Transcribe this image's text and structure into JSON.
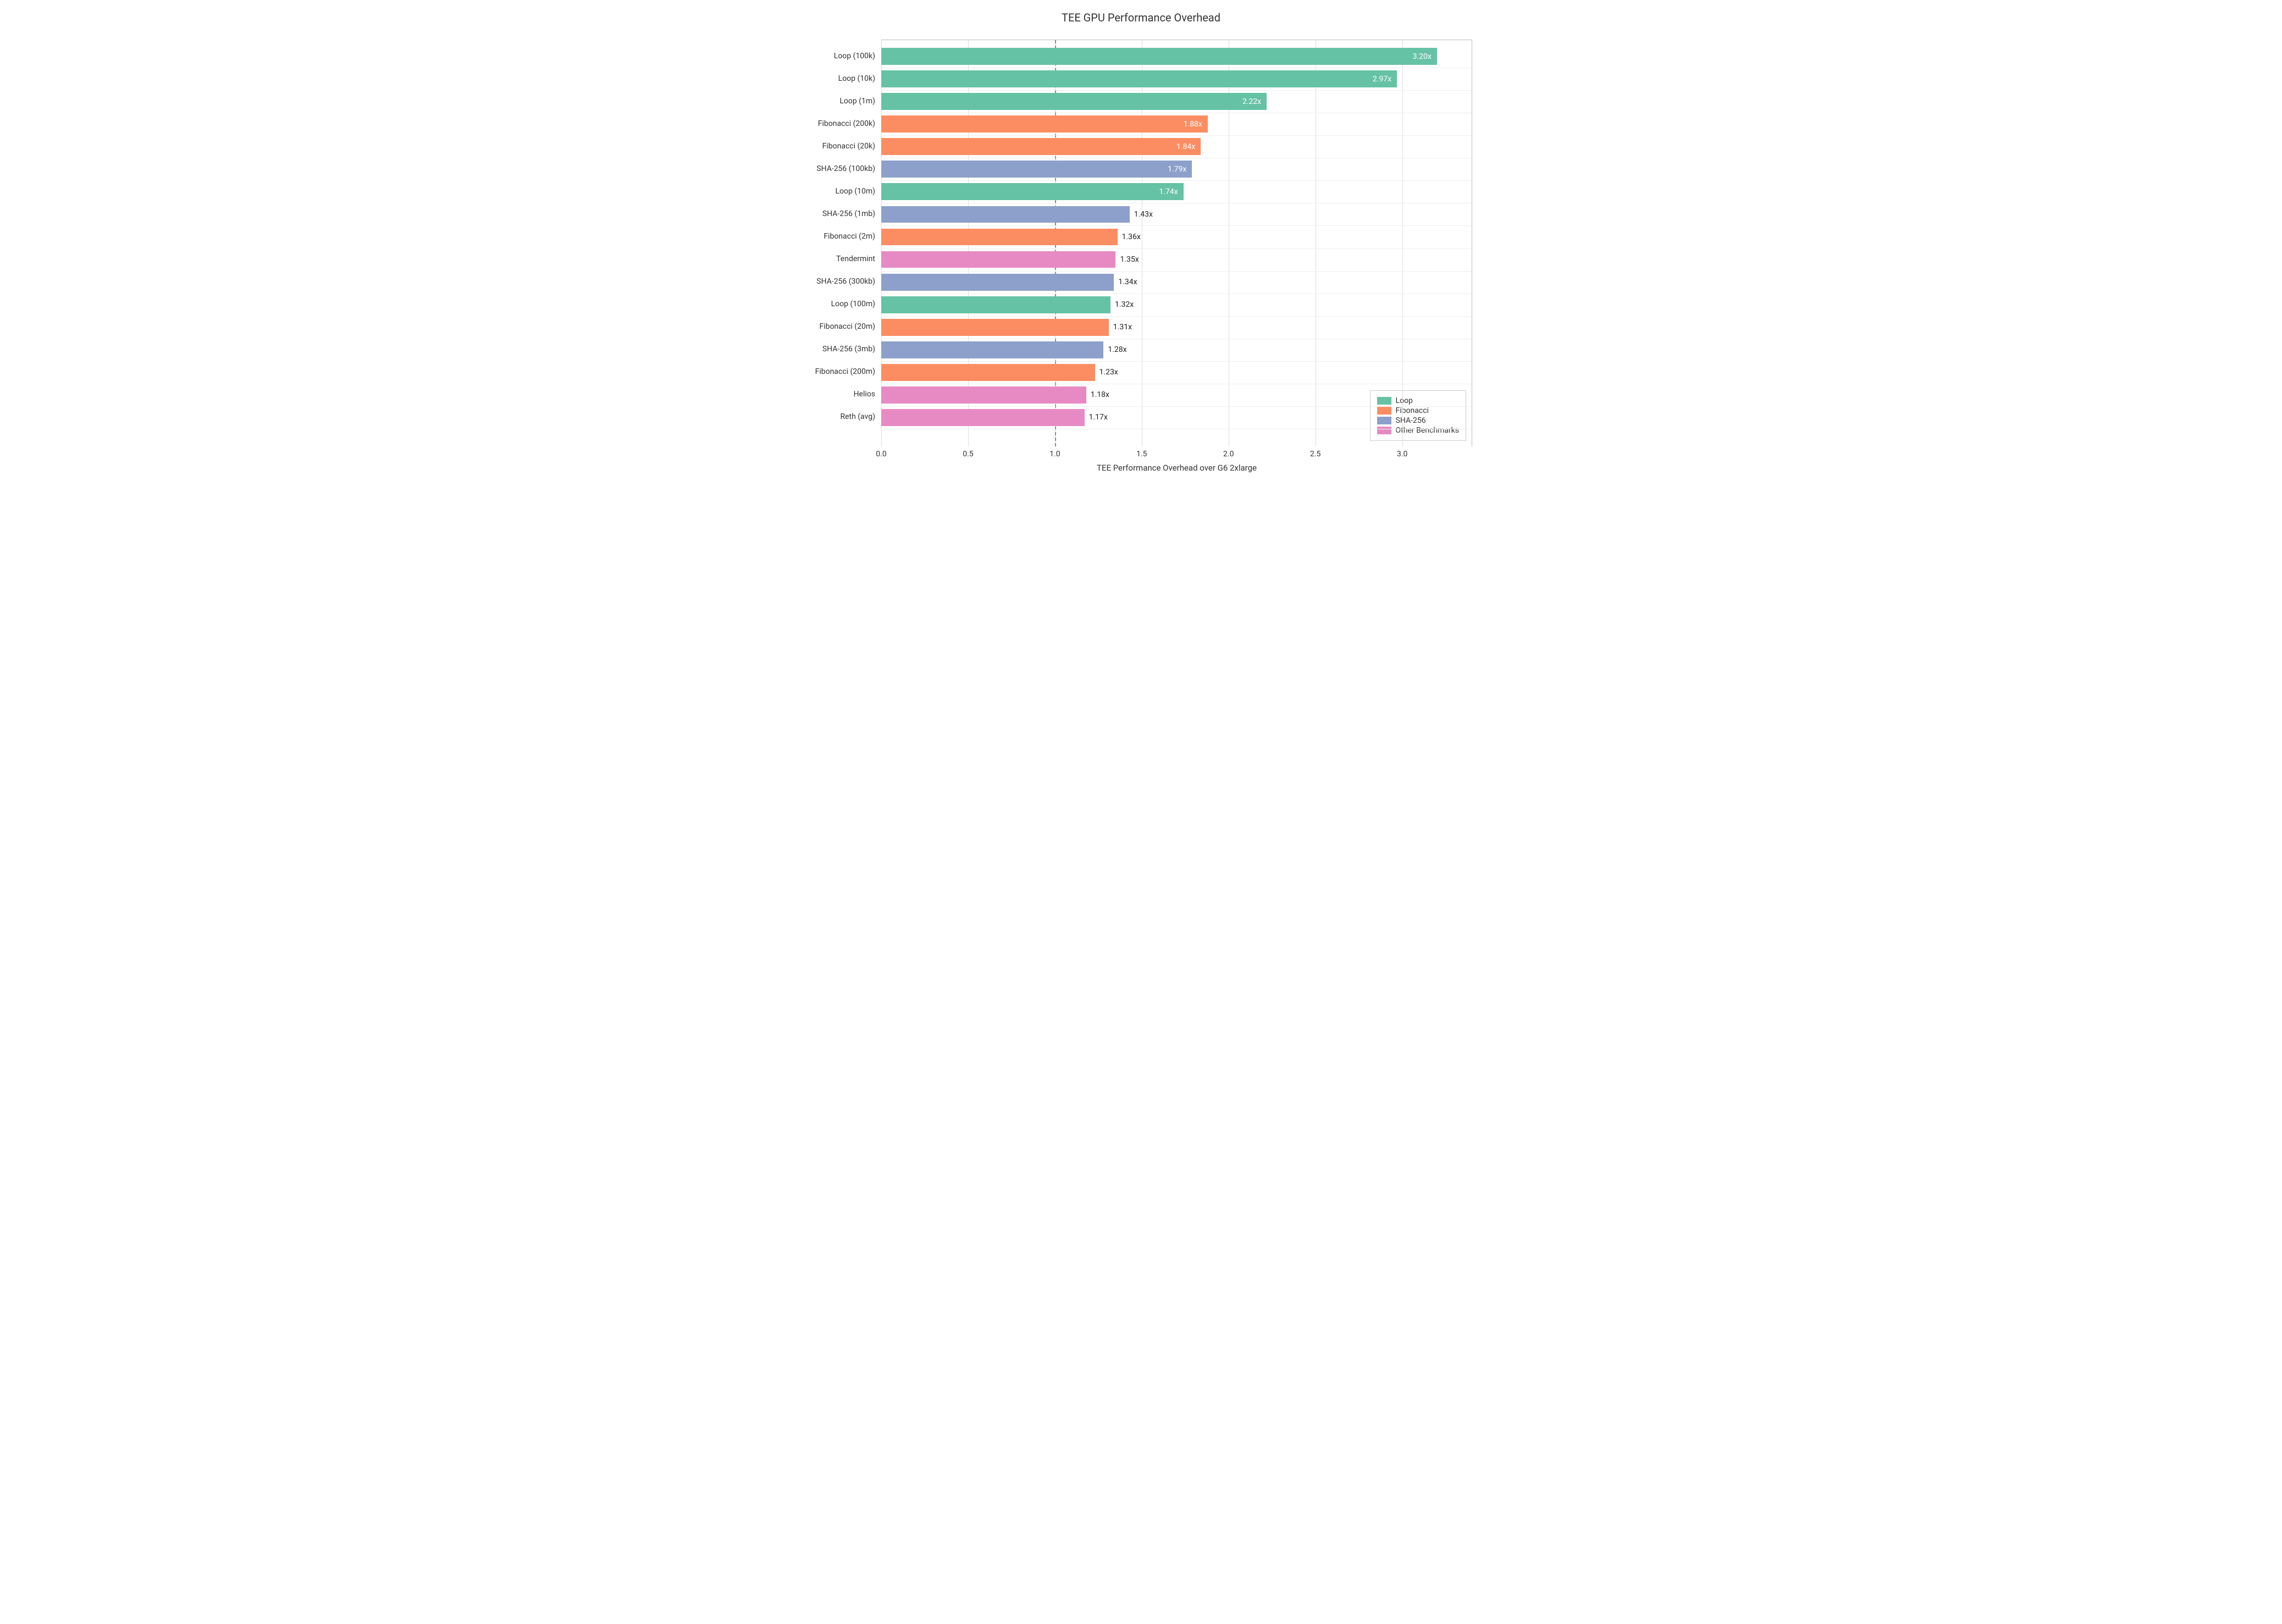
{
  "chart_data": {
    "type": "bar",
    "orientation": "horizontal",
    "title": "TEE GPU Performance Overhead",
    "xlabel": "TEE Performance Overhead over G6 2xlarge",
    "ylabel": "",
    "xlim": [
      0.0,
      3.4
    ],
    "x_ticks": [
      0.0,
      0.5,
      1.0,
      1.5,
      2.0,
      2.5,
      3.0
    ],
    "reference_line": 1.0,
    "bars": [
      {
        "label": "Loop (100k)",
        "value": 3.2,
        "series": "Loop",
        "label_inside": true
      },
      {
        "label": "Loop (10k)",
        "value": 2.97,
        "series": "Loop",
        "label_inside": true
      },
      {
        "label": "Loop (1m)",
        "value": 2.22,
        "series": "Loop",
        "label_inside": true
      },
      {
        "label": "Fibonacci (200k)",
        "value": 1.88,
        "series": "Fibonacci",
        "label_inside": true
      },
      {
        "label": "Fibonacci (20k)",
        "value": 1.84,
        "series": "Fibonacci",
        "label_inside": true
      },
      {
        "label": "SHA-256 (100kb)",
        "value": 1.79,
        "series": "SHA-256",
        "label_inside": true
      },
      {
        "label": "Loop (10m)",
        "value": 1.74,
        "series": "Loop",
        "label_inside": true
      },
      {
        "label": "SHA-256 (1mb)",
        "value": 1.43,
        "series": "SHA-256",
        "label_inside": false
      },
      {
        "label": "Fibonacci (2m)",
        "value": 1.36,
        "series": "Fibonacci",
        "label_inside": false
      },
      {
        "label": "Tendermint",
        "value": 1.35,
        "series": "Other Benchmarks",
        "label_inside": false
      },
      {
        "label": "SHA-256 (300kb)",
        "value": 1.34,
        "series": "SHA-256",
        "label_inside": false
      },
      {
        "label": "Loop (100m)",
        "value": 1.32,
        "series": "Loop",
        "label_inside": false
      },
      {
        "label": "Fibonacci (20m)",
        "value": 1.31,
        "series": "Fibonacci",
        "label_inside": false
      },
      {
        "label": "SHA-256 (3mb)",
        "value": 1.28,
        "series": "SHA-256",
        "label_inside": false
      },
      {
        "label": "Fibonacci (200m)",
        "value": 1.23,
        "series": "Fibonacci",
        "label_inside": false
      },
      {
        "label": "Helios",
        "value": 1.18,
        "series": "Other Benchmarks",
        "label_inside": false
      },
      {
        "label": "Reth (avg)",
        "value": 1.17,
        "series": "Other Benchmarks",
        "label_inside": false
      }
    ],
    "series_colors": {
      "Loop": "#66c2a5",
      "Fibonacci": "#fc8d62",
      "SHA-256": "#8da0cb",
      "Other Benchmarks": "#e78ac3"
    },
    "legend": [
      "Loop",
      "Fibonacci",
      "SHA-256",
      "Other Benchmarks"
    ]
  }
}
